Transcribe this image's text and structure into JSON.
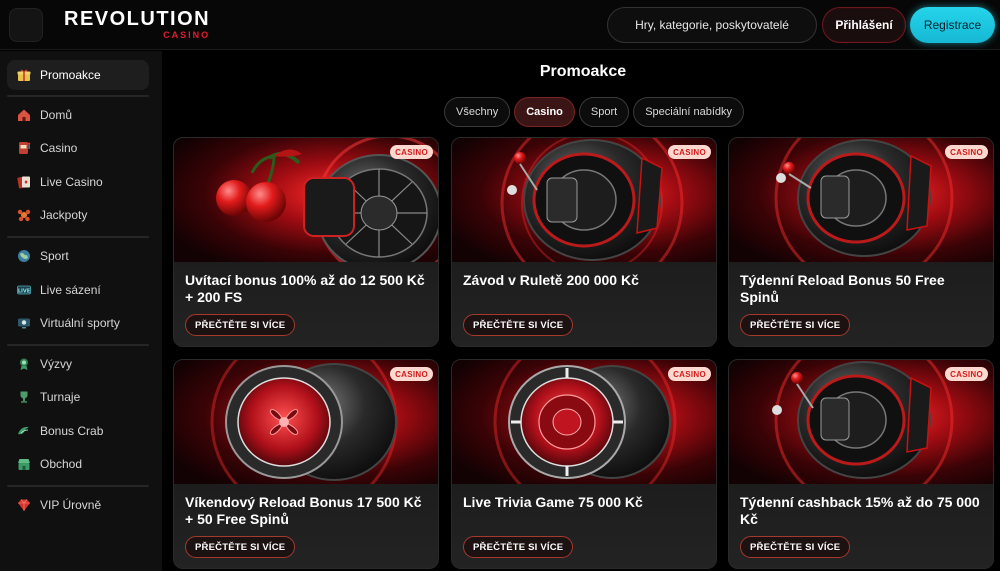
{
  "header": {
    "logo_main": "REVOLUTION",
    "logo_sub": "CASINO",
    "search_placeholder": "Hry, kategorie, poskytovatelé",
    "login_label": "Přihlášení",
    "register_label": "Registrace"
  },
  "sidebar": {
    "items": [
      {
        "label": "Promoakce",
        "icon": "gift-icon"
      },
      {
        "label": "Domů",
        "icon": "home-icon"
      },
      {
        "label": "Casino",
        "icon": "slot-machine-icon"
      },
      {
        "label": "Live Casino",
        "icon": "cards-icon"
      },
      {
        "label": "Jackpoty",
        "icon": "jackpot-icon"
      },
      {
        "label": "Sport",
        "icon": "globe-icon"
      },
      {
        "label": "Live sázení",
        "icon": "live-icon"
      },
      {
        "label": "Virtuální sporty",
        "icon": "virtual-sports-icon"
      },
      {
        "label": "Výzvy",
        "icon": "challenge-icon"
      },
      {
        "label": "Turnaje",
        "icon": "trophy-icon"
      },
      {
        "label": "Bonus Crab",
        "icon": "crab-icon"
      },
      {
        "label": "Obchod",
        "icon": "shop-icon"
      },
      {
        "label": "VIP Úrovně",
        "icon": "diamond-icon"
      }
    ]
  },
  "main": {
    "title": "Promoakce",
    "filters": [
      "Všechny",
      "Casino",
      "Sport",
      "Speciální nabídky"
    ],
    "active_filter": "Casino",
    "cards": [
      {
        "title": "Uvítací bonus 100% až do 12 500 Kč + 200 FS",
        "badge": "CASINO",
        "button": "PŘEČTĚTE SI VÍCE",
        "art": "cherries-roulette"
      },
      {
        "title": "Závod v Ruletě 200 000 Kč",
        "badge": "CASINO",
        "button": "PŘEČTĚTE SI VÍCE",
        "art": "roulette"
      },
      {
        "title": "Týdenní Reload Bonus 50 Free Spinů",
        "badge": "CASINO",
        "button": "PŘEČTĚTE SI VÍCE",
        "art": "roulette"
      },
      {
        "title": "Víkendový Reload Bonus 17 500 Kč + 50 Free Spinů",
        "badge": "CASINO",
        "button": "PŘEČTĚTE SI VÍCE",
        "art": "chip"
      },
      {
        "title": "Live Trivia Game 75 000 Kč",
        "badge": "CASINO",
        "button": "PŘEČTĚTE SI VÍCE",
        "art": "chip"
      },
      {
        "title": "Týdenní cashback 15% až do 75 000 Kč",
        "badge": "CASINO",
        "button": "PŘEČTĚTE SI VÍCE",
        "art": "roulette"
      }
    ]
  },
  "colors": {
    "brand_red": "#e51c2e",
    "accent_cyan": "#1fc8e0",
    "badge_bg": "#ffd9cf"
  }
}
